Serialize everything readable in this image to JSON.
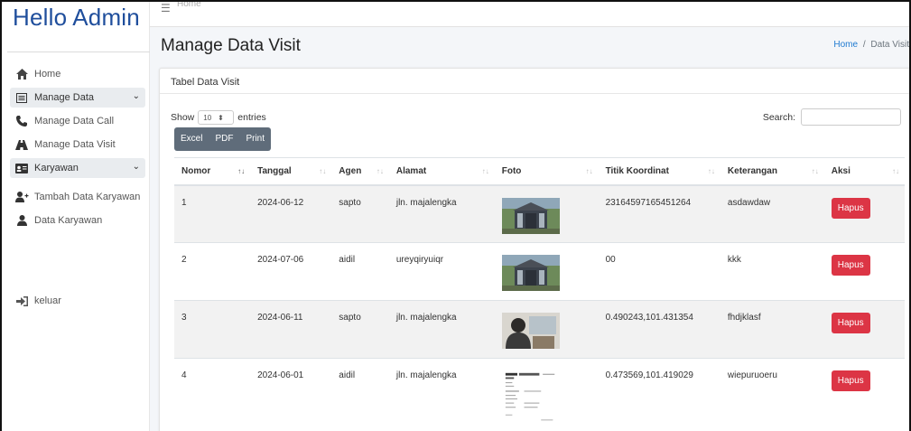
{
  "sidebar": {
    "brand": "Hello Admin",
    "items": [
      {
        "label": "Home",
        "icon": "home-icon"
      },
      {
        "label": "Manage Data",
        "icon": "list-icon"
      },
      {
        "label": "Manage Data Call",
        "icon": "phone-icon"
      },
      {
        "label": "Manage Data Visit",
        "icon": "road-icon"
      },
      {
        "label": "Karyawan",
        "icon": "id-card-icon"
      },
      {
        "label": "Tambah Data Karyawan",
        "icon": "user-plus-icon"
      },
      {
        "label": "Data Karyawan",
        "icon": "user-icon"
      },
      {
        "label": "keluar",
        "icon": "sign-out-icon"
      }
    ]
  },
  "topbar": {
    "home_label": "Home"
  },
  "header": {
    "title": "Manage Data Visit",
    "breadcrumb": {
      "home": "Home",
      "separator": "/",
      "current": "Data Visit"
    }
  },
  "card": {
    "title": "Tabel Data Visit",
    "show_label": "Show",
    "show_value": "10",
    "entries_label": "entries",
    "search_label": "Search:",
    "search_value": "",
    "buttons": [
      "Excel",
      "PDF",
      "Print"
    ]
  },
  "table": {
    "columns": [
      "Nomor",
      "Tanggal",
      "Agen",
      "Alamat",
      "Foto",
      "Titik Koordinat",
      "Keterangan",
      "Aksi"
    ],
    "rows": [
      {
        "nomor": "1",
        "tanggal": "2024-06-12",
        "agen": "sapto",
        "alamat": "jln. majalengka",
        "foto": "building-photo",
        "koordinat": "23164597165451264",
        "keterangan": "asdawdaw",
        "aksi": "Hapus"
      },
      {
        "nomor": "2",
        "tanggal": "2024-07-06",
        "agen": "aidil",
        "alamat": "ureyqiryuiqr",
        "foto": "building-photo",
        "koordinat": "00",
        "keterangan": "kkk",
        "aksi": "Hapus"
      },
      {
        "nomor": "3",
        "tanggal": "2024-06-11",
        "agen": "sapto",
        "alamat": "jln. majalengka",
        "foto": "person-photo",
        "koordinat": "0.490243,101.431354",
        "keterangan": "fhdjklasf",
        "aksi": "Hapus"
      },
      {
        "nomor": "4",
        "tanggal": "2024-06-01",
        "agen": "aidil",
        "alamat": "jln. majalengka",
        "foto": "document-photo",
        "koordinat": "0.473569,101.419029",
        "keterangan": "wiepuruoeru",
        "aksi": "Hapus"
      }
    ]
  },
  "colors": {
    "brand": "#1f4e9c",
    "danger": "#dc3545",
    "link": "#1f7ad1",
    "button_group": "#5f6c7a"
  }
}
